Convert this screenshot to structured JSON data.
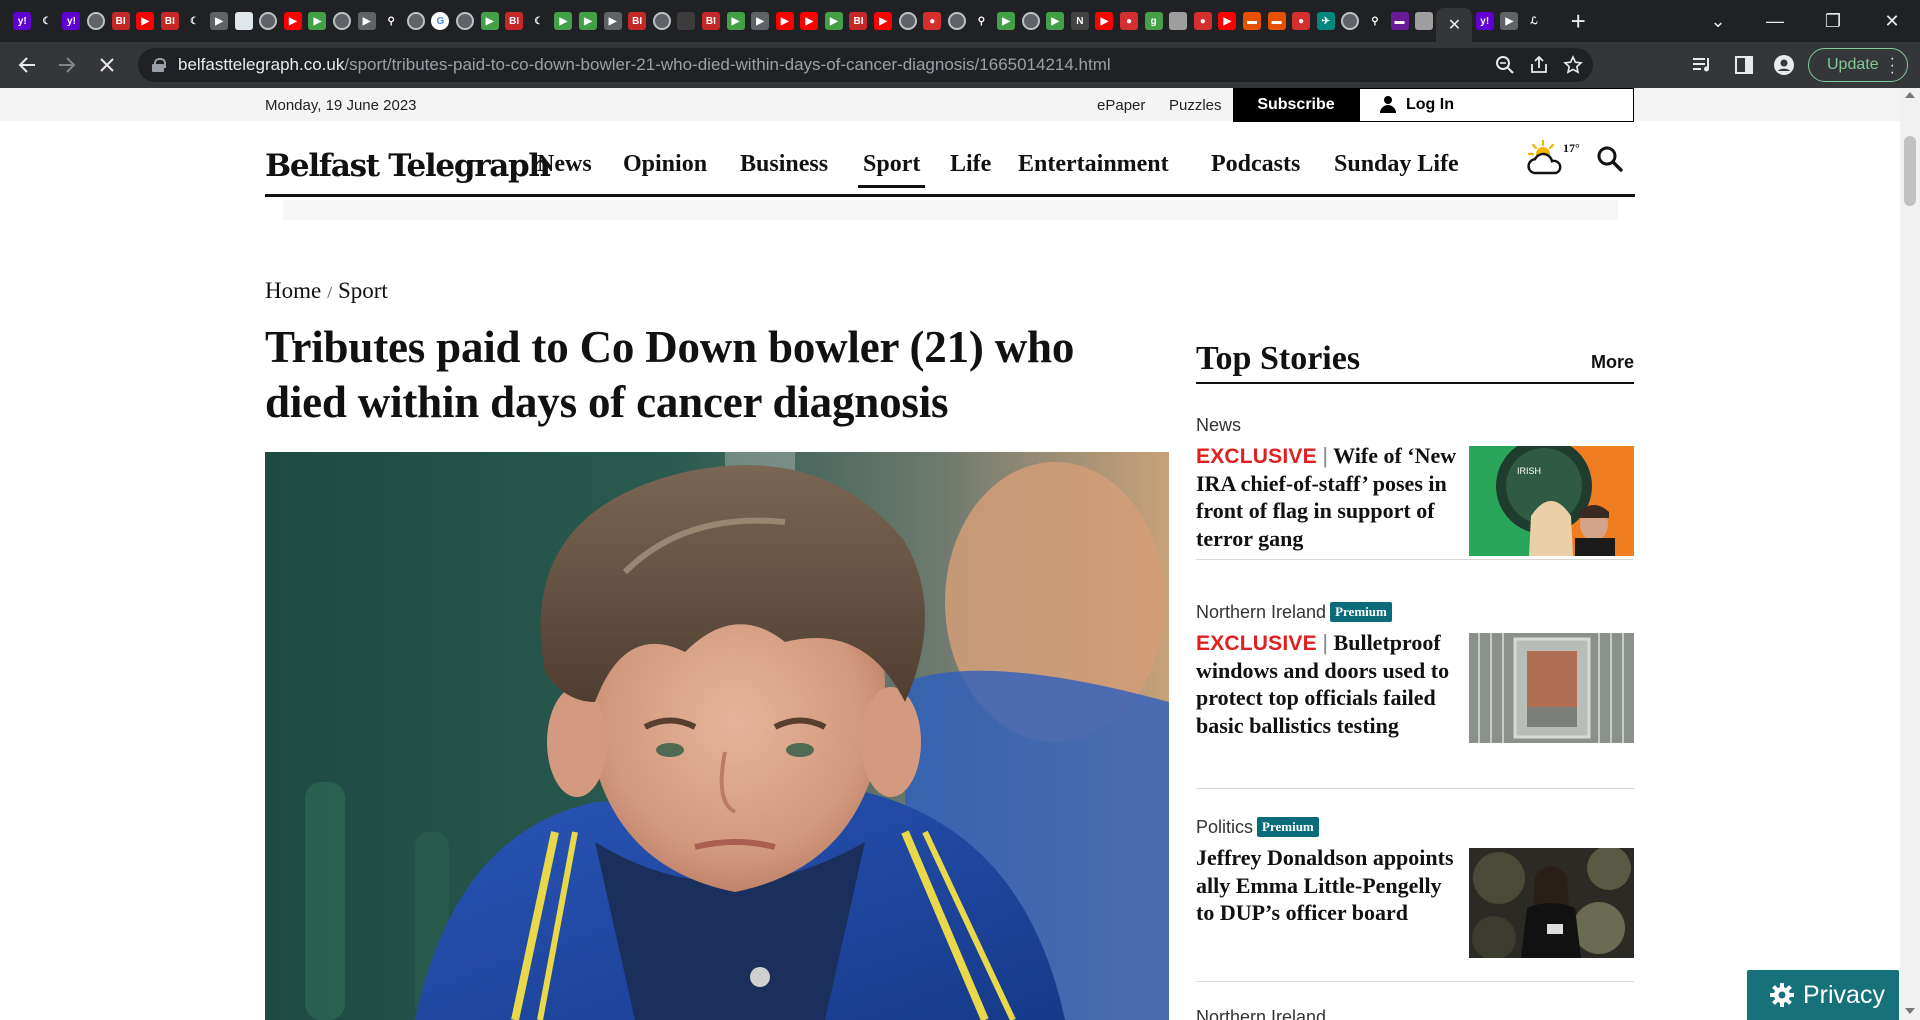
{
  "browser": {
    "url_domain": "belfasttelegraph.co.uk",
    "url_path": "/sport/tributes-paid-to-co-down-bowler-21-who-died-within-days-of-cancer-diagnosis/1665014214.html",
    "update_label": "Update",
    "tab_favicons": [
      {
        "icon": "yahoo-icon",
        "bg": "#6001d2",
        "text": "y!"
      },
      {
        "icon": "halfmoon-icon",
        "bg": "#202124",
        "text": "☾"
      },
      {
        "icon": "yahoo-icon",
        "bg": "#6001d2",
        "text": "y!"
      },
      {
        "icon": "globe-icon",
        "bg": "#5f6368",
        "text": ""
      },
      {
        "icon": "business-insider-icon",
        "bg": "#c62828",
        "text": "BI"
      },
      {
        "icon": "youtube-icon",
        "bg": "#ff0000",
        "text": "▶"
      },
      {
        "icon": "business-insider-icon",
        "bg": "#c62828",
        "text": "BI"
      },
      {
        "icon": "halfmoon-icon",
        "bg": "#202124",
        "text": "☾"
      },
      {
        "icon": "play-icon",
        "bg": "#5f6368",
        "text": "▶"
      },
      {
        "icon": "image-icon",
        "bg": "#dfe6ea",
        "text": ""
      },
      {
        "icon": "globe-icon",
        "bg": "#5f6368",
        "text": ""
      },
      {
        "icon": "youtube-icon",
        "bg": "#ff0000",
        "text": "▶"
      },
      {
        "icon": "green-play-icon",
        "bg": "#43a047",
        "text": "▶"
      },
      {
        "icon": "globe-icon",
        "bg": "#5f6368",
        "text": ""
      },
      {
        "icon": "play-icon",
        "bg": "#5f6368",
        "text": "▶"
      },
      {
        "icon": "search-icon",
        "bg": "#202124",
        "text": "⚲"
      },
      {
        "icon": "globe-icon",
        "bg": "#5f6368",
        "text": ""
      },
      {
        "icon": "google-icon",
        "bg": "#ffffff",
        "text": "G"
      },
      {
        "icon": "globe-icon",
        "bg": "#5f6368",
        "text": ""
      },
      {
        "icon": "green-play-icon",
        "bg": "#43a047",
        "text": "▶"
      },
      {
        "icon": "business-insider-icon",
        "bg": "#c62828",
        "text": "BI"
      },
      {
        "icon": "halfmoon-icon",
        "bg": "#202124",
        "text": "☾"
      },
      {
        "icon": "green-play-icon",
        "bg": "#43a047",
        "text": "▶"
      },
      {
        "icon": "green-play-icon",
        "bg": "#43a047",
        "text": "▶"
      },
      {
        "icon": "play-icon",
        "bg": "#5f6368",
        "text": "▶"
      },
      {
        "icon": "business-insider-icon",
        "bg": "#c62828",
        "text": "BI"
      },
      {
        "icon": "globe-icon",
        "bg": "#5f6368",
        "text": ""
      },
      {
        "icon": "photo-icon",
        "bg": "#3c3c3c",
        "text": ""
      },
      {
        "icon": "business-insider-icon",
        "bg": "#c62828",
        "text": "BI"
      },
      {
        "icon": "green-play-icon",
        "bg": "#43a047",
        "text": "▶"
      },
      {
        "icon": "play-icon",
        "bg": "#5f6368",
        "text": "▶"
      },
      {
        "icon": "youtube-icon",
        "bg": "#ff0000",
        "text": "▶"
      },
      {
        "icon": "youtube-icon",
        "bg": "#ff0000",
        "text": "▶"
      },
      {
        "icon": "green-play-icon",
        "bg": "#43a047",
        "text": "▶"
      },
      {
        "icon": "business-insider-icon",
        "bg": "#c62828",
        "text": "BI"
      },
      {
        "icon": "youtube-icon",
        "bg": "#ff0000",
        "text": "▶"
      },
      {
        "icon": "globe-icon",
        "bg": "#5f6368",
        "text": ""
      },
      {
        "icon": "red-mic-icon",
        "bg": "#d32f2f",
        "text": "●"
      },
      {
        "icon": "globe-icon",
        "bg": "#5f6368",
        "text": ""
      },
      {
        "icon": "search-icon",
        "bg": "#202124",
        "text": "⚲"
      },
      {
        "icon": "green-play-icon",
        "bg": "#43a047",
        "text": "▶"
      },
      {
        "icon": "globe-icon",
        "bg": "#5f6368",
        "text": ""
      },
      {
        "icon": "green-play-icon",
        "bg": "#43a047",
        "text": "▶"
      },
      {
        "icon": "news-icon",
        "bg": "#424242",
        "text": "N"
      },
      {
        "icon": "youtube-icon",
        "bg": "#ff0000",
        "text": "▶"
      },
      {
        "icon": "red-mic-icon",
        "bg": "#d32f2f",
        "text": "●"
      },
      {
        "icon": "g-icon",
        "bg": "#43a047",
        "text": "g"
      },
      {
        "icon": "person-icon",
        "bg": "#9e9e9e",
        "text": ""
      },
      {
        "icon": "red-mic-icon",
        "bg": "#d32f2f",
        "text": "●"
      },
      {
        "icon": "youtube-icon",
        "bg": "#ff0000",
        "text": "▶"
      },
      {
        "icon": "bookmark-icon",
        "bg": "#e65100",
        "text": "▬"
      },
      {
        "icon": "bookmark-icon",
        "bg": "#e65100",
        "text": "▬"
      },
      {
        "icon": "red-mic-icon",
        "bg": "#d32f2f",
        "text": "●"
      },
      {
        "icon": "bird-icon",
        "bg": "#00897b",
        "text": "✈"
      },
      {
        "icon": "globe-icon",
        "bg": "#5f6368",
        "text": ""
      },
      {
        "icon": "search-icon",
        "bg": "#202124",
        "text": "⚲"
      },
      {
        "icon": "purple-icon",
        "bg": "#6a1b9a",
        "text": "▬"
      },
      {
        "icon": "person-icon",
        "bg": "#9e9e9e",
        "text": ""
      }
    ],
    "after_favicons": [
      {
        "icon": "yahoo-icon",
        "bg": "#6001d2",
        "text": "y!"
      },
      {
        "icon": "play-icon",
        "bg": "#5f6368",
        "text": "▶"
      },
      {
        "icon": "wsj-icon",
        "bg": "#202124",
        "text": "ℒ"
      }
    ]
  },
  "utility": {
    "date": "Monday, 19 June 2023",
    "epaper": "ePaper",
    "puzzles": "Puzzles",
    "subscribe": "Subscribe",
    "login": "Log In"
  },
  "masthead": {
    "logo": "Belfast Telegraph",
    "nav": [
      "News",
      "Opinion",
      "Business",
      "Sport",
      "Life",
      "Entertainment",
      "Podcasts",
      "Sunday Life"
    ],
    "active_nav": "Sport",
    "temperature": "17°"
  },
  "breadcrumb": {
    "home": "Home",
    "sep": "/",
    "section": "Sport"
  },
  "article": {
    "headline": "Tributes paid to Co Down bowler (21) who died within days of cancer diagnosis"
  },
  "sidebar": {
    "title": "Top Stories",
    "more": "More",
    "stories": [
      {
        "kicker": "News",
        "premium": "",
        "exclusive": "EXCLUSIVE",
        "title": "Wife of ‘New IRA chief-of-staff’ poses in front of flag in support of terror gang"
      },
      {
        "kicker": "Northern Ireland",
        "premium": "Premium",
        "exclusive": "EXCLUSIVE",
        "title": "Bulletproof windows and doors used to protect top officials failed basic ballistics testing"
      },
      {
        "kicker": "Politics",
        "premium": "Premium",
        "exclusive": "",
        "title": "Jeffrey Donaldson appoints ally Emma Little-Pengelly to DUP’s officer board"
      },
      {
        "kicker": "Northern Ireland",
        "premium": "",
        "exclusive": "",
        "title": ""
      }
    ]
  },
  "privacy": {
    "label": "Privacy"
  },
  "colors": {
    "exclusive": "#e02020",
    "premium": "#0a6c7a",
    "privacy": "#17717a",
    "update": "#81c995"
  }
}
